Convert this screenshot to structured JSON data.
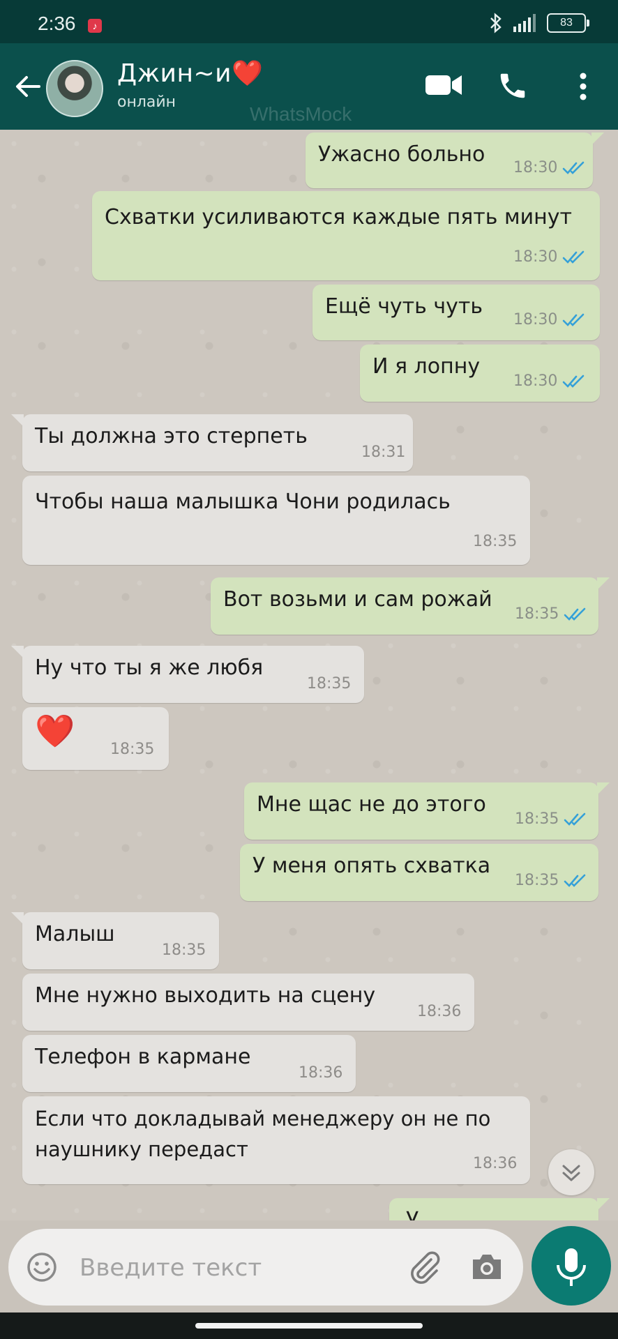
{
  "status_bar": {
    "time": "2:36",
    "battery": "83"
  },
  "header": {
    "contact_name": "Джин~и❤️",
    "contact_status": "онлайн",
    "watermark": "WhatsMock"
  },
  "messages": [
    {
      "dir": "out",
      "text": "Ужасно больно",
      "time": "18:30",
      "read": true
    },
    {
      "dir": "out",
      "text": "Схватки усиливаются каждые пять минут",
      "time": "18:30",
      "read": true
    },
    {
      "dir": "out",
      "text": "Ещё чуть чуть",
      "time": "18:30",
      "read": true
    },
    {
      "dir": "out",
      "text": "И я лопну",
      "time": "18:30",
      "read": true
    },
    {
      "dir": "in",
      "text": "Ты должна это стерпеть",
      "time": "18:31"
    },
    {
      "dir": "in",
      "text": "Чтобы наша малышка Чони родилась",
      "time": "18:35"
    },
    {
      "dir": "out",
      "text": "Вот возьми и сам рожай",
      "time": "18:35",
      "read": true
    },
    {
      "dir": "in",
      "text": "Ну что ты я же любя",
      "time": "18:35"
    },
    {
      "dir": "in",
      "text": "❤️",
      "time": "18:35"
    },
    {
      "dir": "out",
      "text": "Мне щас не до этого",
      "time": "18:35",
      "read": true
    },
    {
      "dir": "out",
      "text": "У меня опять схватка",
      "time": "18:35",
      "read": true
    },
    {
      "dir": "in",
      "text": "Малыш",
      "time": "18:35"
    },
    {
      "dir": "in",
      "text": "Мне нужно выходить на сцену",
      "time": "18:36"
    },
    {
      "dir": "in",
      "text": "Телефон в кармане",
      "time": "18:36"
    },
    {
      "dir": "in",
      "text": "Если что докладывай менеджеру он не по наушнику передаст",
      "time": "18:36"
    },
    {
      "dir": "out",
      "text": "У",
      "time": ""
    }
  ],
  "input": {
    "placeholder": "Введите текст"
  },
  "icons": {
    "back": "arrow-left-icon",
    "video": "video-camera-icon",
    "call": "phone-icon",
    "menu": "more-vertical-icon",
    "emoji": "emoji-icon",
    "attach": "paperclip-icon",
    "camera": "camera-icon",
    "mic": "microphone-icon",
    "scroll": "chevron-double-down-icon"
  },
  "colors": {
    "header": "#0b504c",
    "status_bar": "#073a37",
    "outgoing_bubble": "#d3e3bd",
    "incoming_bubble": "#e4e2df",
    "read_ticks": "#34a0d8",
    "mic_button": "#0b7b72"
  }
}
